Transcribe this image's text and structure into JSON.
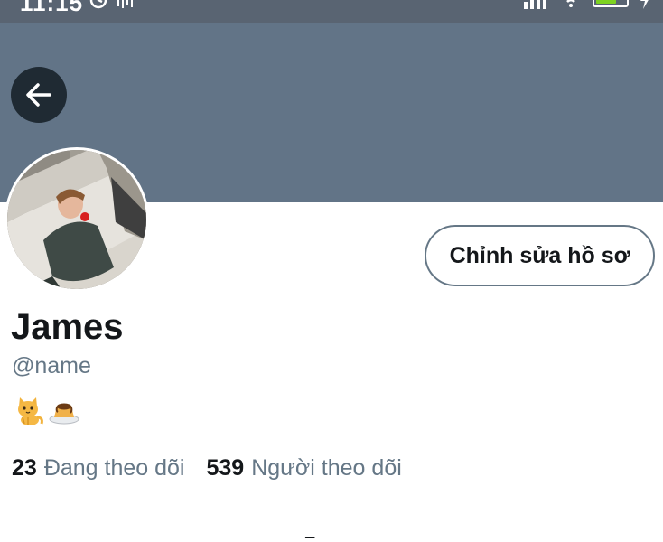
{
  "status_bar": {
    "time": "11:15",
    "battery_level": "72",
    "battery_fraction": 0.72,
    "icons": [
      "sync-icon",
      "wave-icon",
      "signal-icon",
      "wifi-icon",
      "battery-icon"
    ]
  },
  "header": {
    "back_icon": "arrow-left-icon"
  },
  "profile": {
    "edit_button_label": "Chỉnh sửa hồ sơ",
    "display_name": "James",
    "handle": "@name",
    "bio_emojis": [
      "cat-emoji",
      "pudding-emoji"
    ],
    "following_count": "23",
    "following_label": "Đang theo dõi",
    "followers_count": "539",
    "followers_label": "Người theo dõi"
  },
  "colors": {
    "banner": "#627487",
    "status_bar": "#596472",
    "back_button": "#1f2a33",
    "text_primary": "#14171a",
    "text_secondary": "#657786",
    "battery": "#7ed321"
  }
}
